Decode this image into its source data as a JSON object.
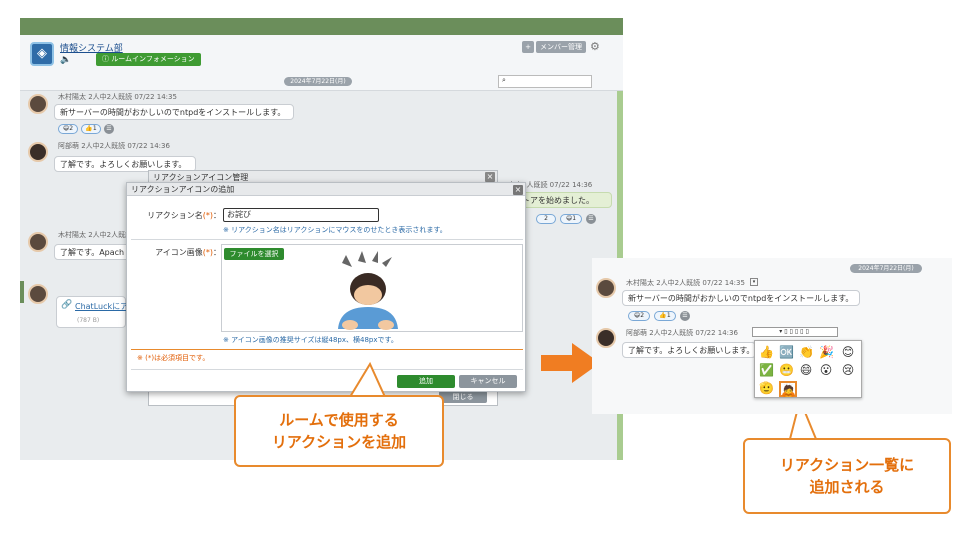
{
  "app": {
    "room_name": "情報システム部",
    "info_button": "ルームインフォメーション",
    "member_button": "メンバー管理",
    "date_divider": "2024年7月22日(月)",
    "search_placeholder": "",
    "messages": [
      {
        "author": "木村陽太 2人中2人既読 07/22 14:35",
        "text": "新サーバーの時間がおかしいのでntpdをインストールします。",
        "reactions": [
          "😄2",
          "👍1"
        ]
      },
      {
        "author": "阿部萌 2人中2人既読 07/22 14:36",
        "text": "了解です。よろしくお願いします。",
        "reactions": []
      },
      {
        "author": "木村陽太 2人中2人既読",
        "text": "了解です。Apach",
        "reactions": []
      },
      {
        "author": "",
        "text": "ChatLuckにア",
        "reactions": [],
        "file_size": "(787 B)"
      }
    ],
    "back_panel": {
      "title": "リアクションアイコン管理",
      "side_meta": "人中2人既読 07/22 14:36",
      "side_text": "ストアを始めました。",
      "side_reactions": [
        "2",
        "😄1"
      ],
      "close_label": "閉じる"
    },
    "dialog": {
      "title": "リアクションアイコンの追加",
      "name_label": "リアクション名",
      "required_mark": "(*)",
      "name_colon": "：",
      "name_value": "お詫び",
      "name_note": "※ リアクション名はリアクションにマウスをのせたとき表示されます。",
      "image_label": "アイコン画像",
      "file_button": "ファイルを選択",
      "image_note": "※ アイコン画像の推奨サイズは縦48px、横48pxです。",
      "required_note": "※ (*)は必須項目です。",
      "add_button": "追加",
      "cancel_button": "キャンセル"
    }
  },
  "callout_left": {
    "line1": "ルームで使用する",
    "line2": "リアクションを追加"
  },
  "callout_right": {
    "line1": "リアクション一覧に",
    "line2": "追加される"
  },
  "preview": {
    "date_divider": "2024年7月22日(月)",
    "msg1_author": "木村陽太 2人中2人既読 07/22 14:35",
    "msg1_text": "新サーバーの時間がおかしいのでntpdをインストールします。",
    "msg1_reactions": [
      "😄2",
      "👍1"
    ],
    "msg2_author": "阿部萌 2人中2人既読 07/22 14:36",
    "msg2_text": "了解です。よろしくお願いします。",
    "emoji_grid": [
      "👍",
      "🆗",
      "👏",
      "🎉",
      "😊",
      "✅",
      "😬",
      "😄",
      "😮",
      "😢",
      "🫡",
      "🙇"
    ]
  },
  "colors": {
    "accent_green": "#3f9b33",
    "callout_orange": "#e88a2d",
    "arrow_orange": "#f07d22"
  }
}
